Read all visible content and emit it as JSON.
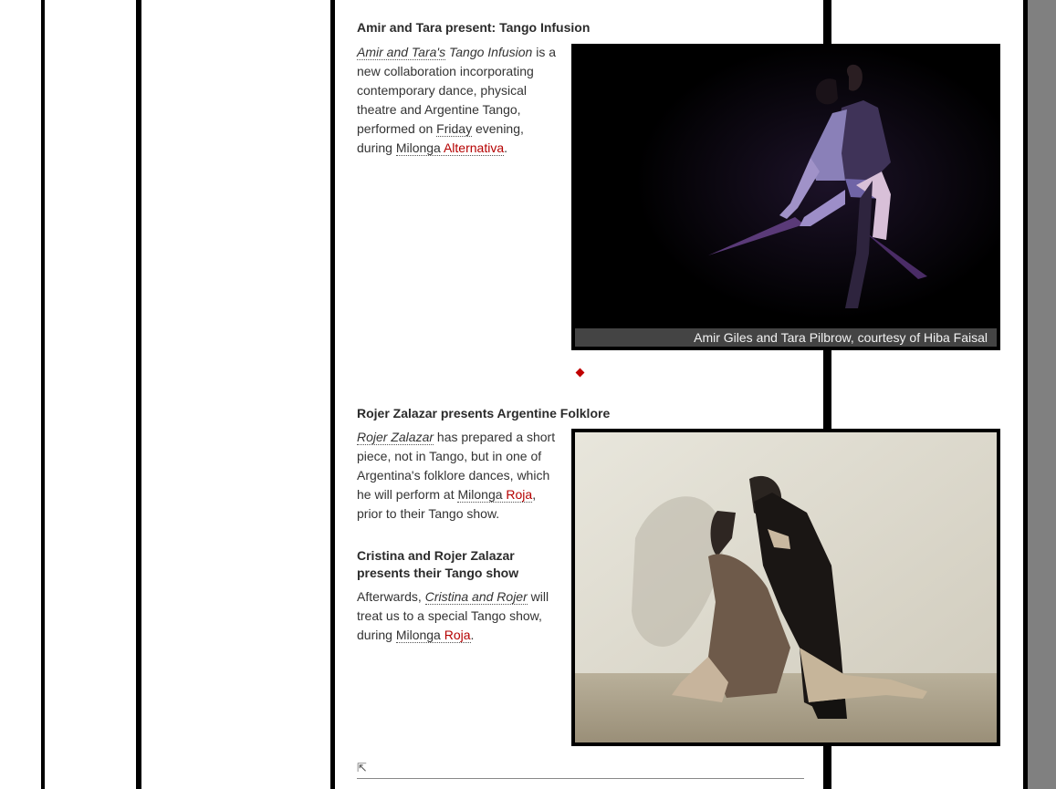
{
  "section1": {
    "heading": "Amir and Tara present: Tango Infusion",
    "paragraph": {
      "link_performers": "Amir and Tara's",
      "title": "Tango Infusion",
      "text1": " is a new collaboration incorporating contemporary dance, physical theatre and Argentine Tango, performed on ",
      "link_day": "Friday",
      "text2": " evening, during ",
      "link_milonga": "Milonga",
      "link_milonga_name": "Alternativa",
      "text3": "."
    },
    "photo_caption": "Amir Giles and Tara Pilbrow, courtesy of Hiba Faisal"
  },
  "section2": {
    "heading": "Rojer Zalazar presents Argentine Folklore",
    "paragraph": {
      "link_performer": "Rojer Zalazar",
      "text1": " has prepared a short piece, not in Tango, but in one of Argentina's folklore dances, which he will perform at ",
      "link_milonga": "Milonga",
      "link_milonga_name": "Roja",
      "text2": ", prior to their Tango show."
    }
  },
  "section3": {
    "heading": "Cristina and Rojer Zalazar presents their Tango show",
    "paragraph": {
      "text1": "Afterwards, ",
      "link_performers": "Cristina and Rojer",
      "text2": " will treat us to a special Tango show, during ",
      "link_milonga": "Milonga",
      "link_milonga_name": "Roja",
      "text3": "."
    }
  },
  "back_to_top_icon": "arrow-up-left-icon",
  "separator_icon": "diamond-icon",
  "colors": {
    "link_red": "#b50000",
    "caption_bg": "#444444",
    "scrollbar": "#808080"
  }
}
